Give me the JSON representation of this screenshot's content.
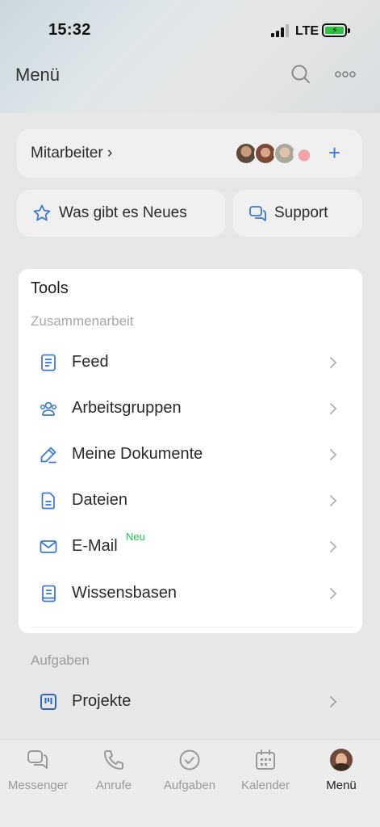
{
  "status_bar": {
    "time": "15:32",
    "network": "LTE",
    "battery_charging": true
  },
  "header": {
    "title": "Menü",
    "icons": [
      "search-icon",
      "more-icon"
    ]
  },
  "employees": {
    "label": "Mitarbeiter",
    "add_icon": "plus-icon"
  },
  "quick_actions": [
    {
      "label": "Was gibt es Neues",
      "icon": "star-icon"
    },
    {
      "label": "Support",
      "icon": "chat-icon"
    }
  ],
  "tools": {
    "title": "Tools",
    "section": "Zusammenarbeit",
    "items": [
      {
        "label": "Feed",
        "icon": "feed-icon"
      },
      {
        "label": "Arbeitsgruppen",
        "icon": "groups-icon"
      },
      {
        "label": "Meine Dokumente",
        "icon": "pen-icon"
      },
      {
        "label": "Dateien",
        "icon": "file-icon"
      },
      {
        "label": "E-Mail",
        "icon": "mail-icon",
        "badge": "Neu"
      },
      {
        "label": "Wissensbasen",
        "icon": "book-icon"
      }
    ]
  },
  "tasks_section": {
    "label": "Aufgaben",
    "item": "Projekte",
    "icon": "projects-icon"
  },
  "tab_bar": [
    {
      "label": "Messenger",
      "icon": "messenger-icon"
    },
    {
      "label": "Anrufe",
      "icon": "phone-icon"
    },
    {
      "label": "Aufgaben",
      "icon": "check-circle-icon"
    },
    {
      "label": "Kalender",
      "icon": "calendar-icon"
    },
    {
      "label": "Menü",
      "icon": "avatar-icon",
      "active": true
    }
  ],
  "colors": {
    "accent": "#3d79d6",
    "new_badge": "#27c255",
    "muted": "#a8a8a8"
  }
}
